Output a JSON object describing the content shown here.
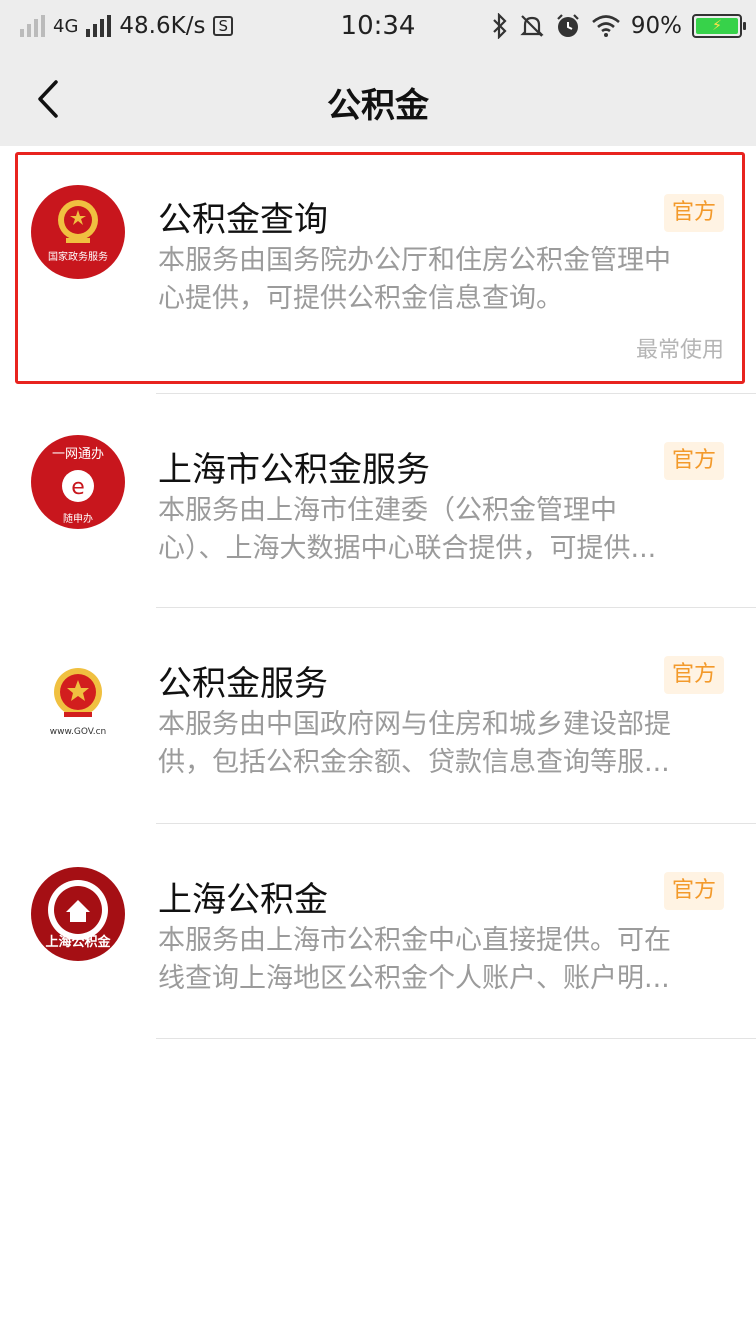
{
  "status_bar": {
    "network": "4G",
    "speed": "48.6K/s",
    "s_icon_label": "S",
    "time": "10:34",
    "battery": "90%"
  },
  "nav": {
    "title": "公积金"
  },
  "items": [
    {
      "title": "公积金查询",
      "badge": "官方",
      "desc_line1": "本服务由国务院办公厅和住房公积金管理中",
      "desc_line2": "心提供，可提供公积金信息查询。",
      "note": "最常使用",
      "logo_caption": "国家政务服务"
    },
    {
      "title": "上海市公积金服务",
      "badge": "官方",
      "desc_line1": "本服务由上海市住建委（公积金管理中",
      "desc_line2": "心）、上海大数据中心联合提供，可提供...",
      "logo_top": "一网通办",
      "logo_bottom": "随申办"
    },
    {
      "title": "公积金服务",
      "badge": "官方",
      "desc_line1": "本服务由中国政府网与住房和城乡建设部提",
      "desc_line2": "供，包括公积金余额、贷款信息查询等服...",
      "logo_caption": "www.GOV.cn"
    },
    {
      "title": "上海公积金",
      "badge": "官方",
      "desc_line1": "本服务由上海市公积金中心直接提供。可在",
      "desc_line2": "线查询上海地区公积金个人账户、账户明...",
      "logo_caption": "上海公积金"
    }
  ],
  "colors": {
    "highlight": "#e8231f",
    "badge_text": "#f39a2b",
    "badge_bg": "#fff3e3",
    "emblem_red": "#c8161d"
  }
}
